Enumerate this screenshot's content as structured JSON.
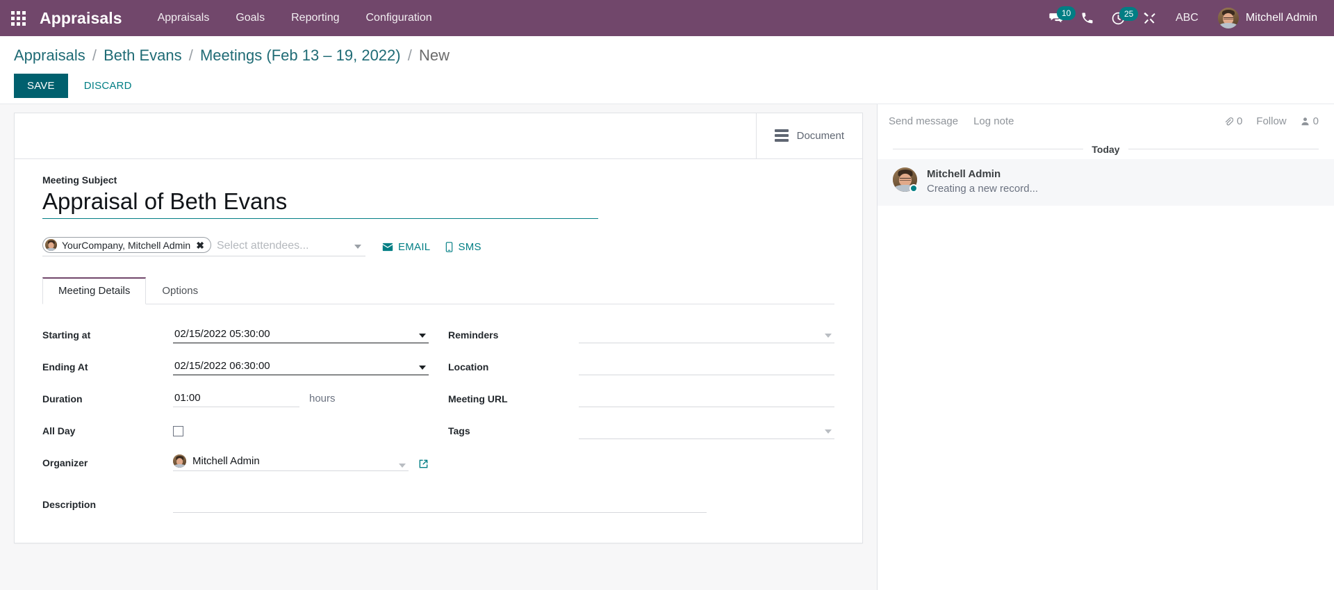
{
  "navbar": {
    "apps_icon": "apps-grid-icon",
    "brand": "Appraisals",
    "menu": [
      {
        "label": "Appraisals"
      },
      {
        "label": "Goals"
      },
      {
        "label": "Reporting"
      },
      {
        "label": "Configuration"
      }
    ],
    "systray": {
      "messages_icon": "comments-icon",
      "messages_count": "10",
      "phone_icon": "phone-icon",
      "activities_icon": "clock-icon",
      "activities_count": "25",
      "tools_icon": "wrench-icon",
      "debug_label": "ABC"
    },
    "user": {
      "name": "Mitchell Admin",
      "avatar_icon": "user-avatar"
    },
    "accent_purple": "#71476B",
    "accent_teal": "#017E84"
  },
  "control_panel": {
    "breadcrumb": [
      {
        "label": "Appraisals",
        "active": false
      },
      {
        "label": "Beth Evans",
        "active": false
      },
      {
        "label": "Meetings (Feb 13 – 19, 2022)",
        "active": false
      },
      {
        "label": "New",
        "active": true
      }
    ],
    "separator": "/",
    "save_label": "SAVE",
    "discard_label": "DISCARD"
  },
  "form": {
    "stat_buttons": [
      {
        "label": "Document",
        "icon": "bars-icon"
      }
    ],
    "subject": {
      "label": "Meeting Subject",
      "value": "Appraisal of Beth Evans"
    },
    "attendees": {
      "tag": "YourCompany, Mitchell Admin",
      "remove_icon": "close-icon",
      "placeholder": "Select attendees...",
      "email_label": "EMAIL",
      "email_icon": "envelope-icon",
      "sms_label": "SMS",
      "sms_icon": "mobile-icon"
    },
    "tabs": [
      {
        "label": "Meeting Details",
        "active": true
      },
      {
        "label": "Options",
        "active": false
      }
    ],
    "left_fields": {
      "starting_at": {
        "label": "Starting at",
        "value": "02/15/2022 05:30:00"
      },
      "ending_at": {
        "label": "Ending At",
        "value": "02/15/2022 06:30:00"
      },
      "duration": {
        "label": "Duration",
        "value": "01:00",
        "unit": "hours"
      },
      "all_day": {
        "label": "All Day",
        "checked": false
      },
      "organizer": {
        "label": "Organizer",
        "value": "Mitchell Admin",
        "external_link_icon": "external-link-icon"
      }
    },
    "right_fields": {
      "reminders": {
        "label": "Reminders",
        "value": ""
      },
      "location": {
        "label": "Location",
        "value": ""
      },
      "meeting_url": {
        "label": "Meeting URL",
        "value": ""
      },
      "tags": {
        "label": "Tags",
        "value": ""
      }
    },
    "description": {
      "label": "Description",
      "value": ""
    }
  },
  "chatter": {
    "send_message": "Send message",
    "log_note": "Log note",
    "attachment_icon": "paperclip-icon",
    "attachment_count": "0",
    "follow_label": "Follow",
    "followers_icon": "user-icon",
    "followers_count": "0",
    "divider_label": "Today",
    "messages": [
      {
        "author": "Mitchell Admin",
        "body": "Creating a new record...",
        "avatar_icon": "user-avatar"
      }
    ]
  }
}
